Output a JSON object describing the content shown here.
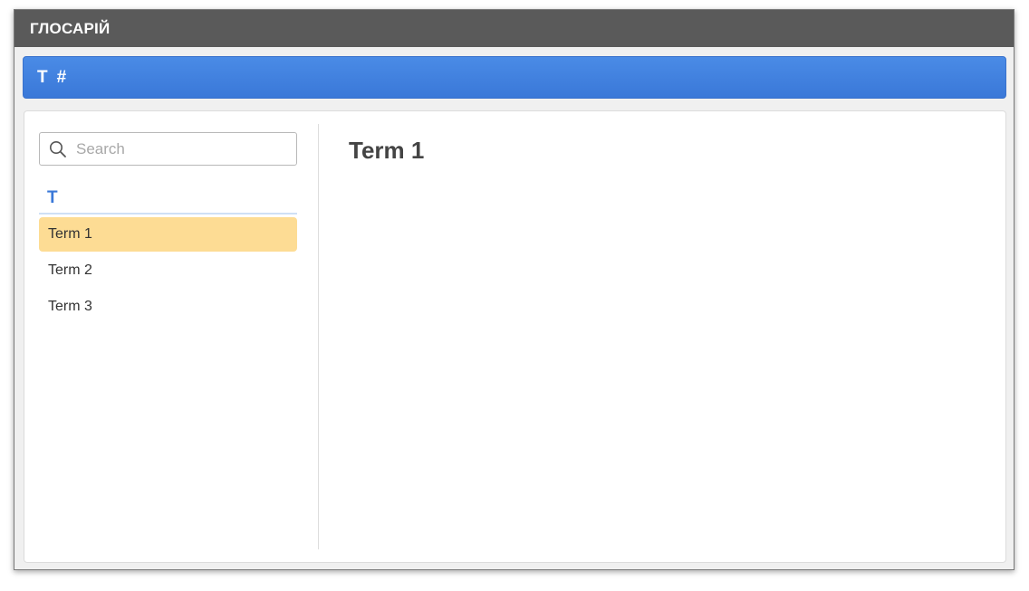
{
  "window": {
    "title": "ГЛОСАРІЙ"
  },
  "letter_nav": {
    "items": [
      "T",
      "#"
    ]
  },
  "search": {
    "placeholder": "Search",
    "value": "",
    "icon": "search-icon"
  },
  "glossary": {
    "group_letter": "T",
    "terms": [
      "Term 1",
      "Term 2",
      "Term 3"
    ],
    "selected": "Term 1"
  },
  "detail": {
    "title": "Term 1"
  },
  "colors": {
    "titlebar_bg": "#5a5a5a",
    "accent": "#3a78d8",
    "selected_bg": "#fddc94",
    "group_underline": "#cfe0f5"
  }
}
